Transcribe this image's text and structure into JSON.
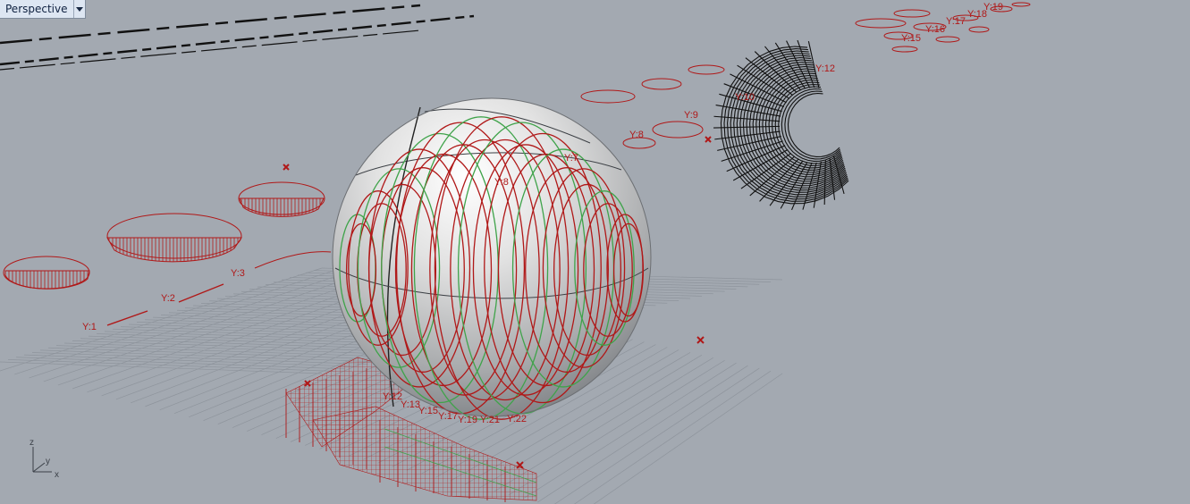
{
  "viewport": {
    "name": "Perspective",
    "colors": {
      "background": "#a3a9b1",
      "curves": "#b01818",
      "highlight": "#3fa34a",
      "wire": "#111111",
      "grid": "#8e949c"
    }
  },
  "axes": {
    "z": "z",
    "y": "y",
    "x": "x"
  },
  "slice_labels": [
    "Y:1",
    "Y:2",
    "Y:3",
    "Y:7",
    "Y:8",
    "Y:8",
    "Y:9",
    "Y:10",
    "Y:12",
    "Y:15",
    "Y:16",
    "Y:17",
    "Y:18",
    "Y:19",
    "Y:12",
    "Y:13",
    "Y:15",
    "Y:17",
    "Y:19",
    "Y:21",
    "Y:22"
  ]
}
